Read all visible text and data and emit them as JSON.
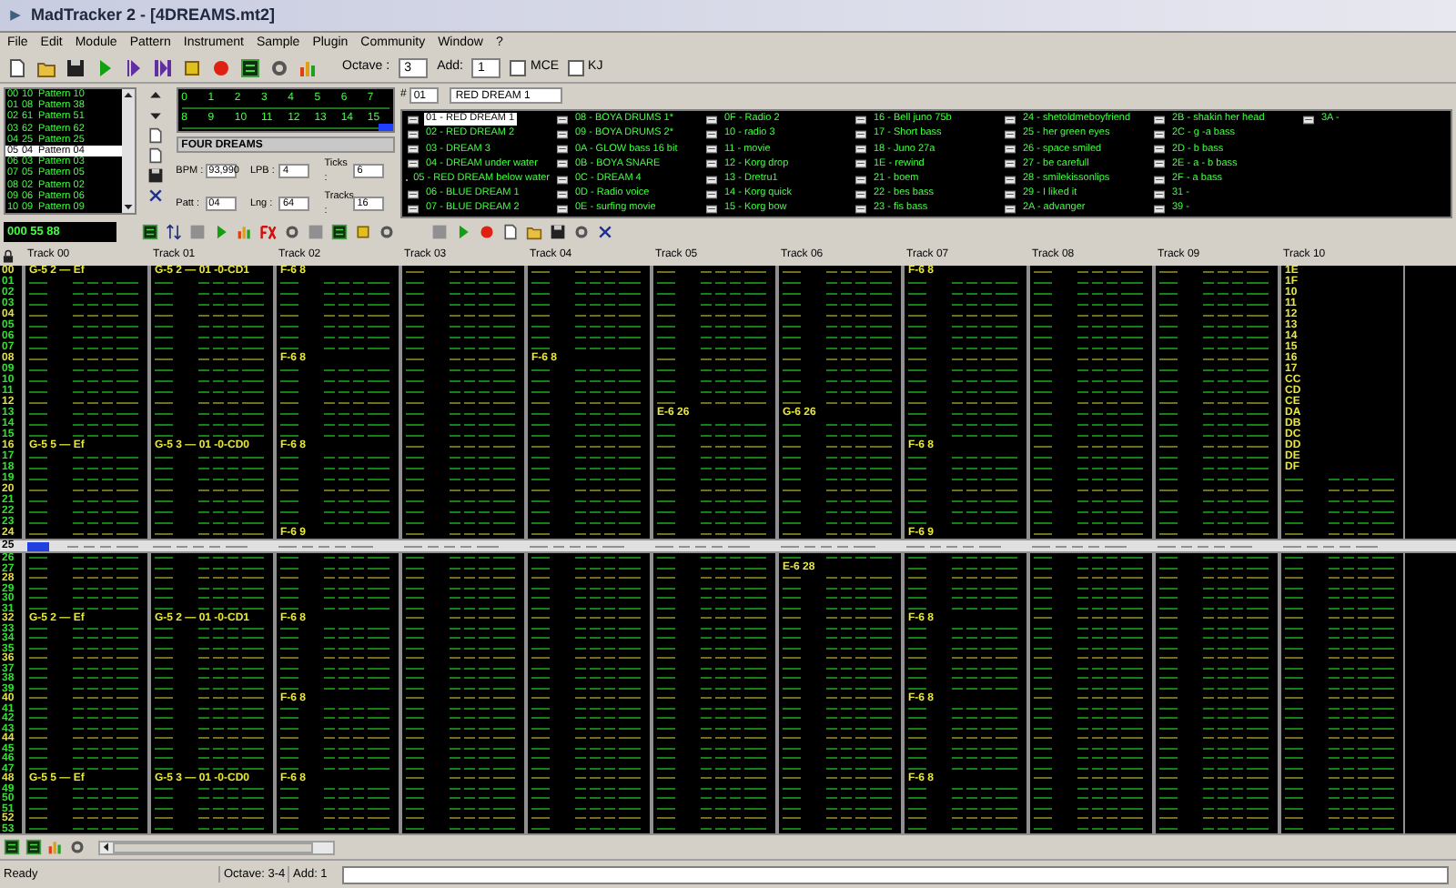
{
  "window": {
    "title": "MadTracker 2 - [4DREAMS.mt2]"
  },
  "menu": [
    "File",
    "Edit",
    "Module",
    "Pattern",
    "Instrument",
    "Sample",
    "Plugin",
    "Community",
    "Window",
    "?"
  ],
  "toolbar": {
    "octave_label": "Octave :",
    "octave": "3",
    "add_label": "Add:",
    "add": "1",
    "checkboxes": [
      {
        "label": "MCE",
        "checked": false
      },
      {
        "label": "KJ",
        "checked": false
      }
    ]
  },
  "pattern_list": [
    {
      "index": "00",
      "pattern": "10",
      "name": "Pattern 10",
      "selected": false
    },
    {
      "index": "01",
      "pattern": "08",
      "name": "Pattern 38",
      "selected": false
    },
    {
      "index": "02",
      "pattern": "61",
      "name": "Pattern 51",
      "selected": false
    },
    {
      "index": "03",
      "pattern": "62",
      "name": "Pattern 62",
      "selected": false
    },
    {
      "index": "04",
      "pattern": "25",
      "name": "Pattern 25",
      "selected": false
    },
    {
      "index": "05",
      "pattern": "04",
      "name": "Pattern 04",
      "selected": true
    },
    {
      "index": "06",
      "pattern": "03",
      "name": "Pattern 03",
      "selected": false
    },
    {
      "index": "07",
      "pattern": "05",
      "name": "Pattern 05",
      "selected": false
    },
    {
      "index": "08",
      "pattern": "02",
      "name": "Pattern 02",
      "selected": false
    },
    {
      "index": "09",
      "pattern": "06",
      "name": "Pattern 06",
      "selected": false
    },
    {
      "index": "10",
      "pattern": "09",
      "name": "Pattern 09",
      "selected": false
    }
  ],
  "order_grid": [
    [
      "0",
      "1",
      "2",
      "3",
      "4",
      "5",
      "6",
      "7"
    ],
    [
      "8",
      "9",
      "10",
      "11",
      "12",
      "13",
      "14",
      "15"
    ]
  ],
  "song": {
    "name": "FOUR DREAMS",
    "fields": [
      {
        "label": "BPM :",
        "value": "93,990"
      },
      {
        "label": "LPB :",
        "value": "4"
      },
      {
        "label": "Ticks :",
        "value": "6"
      },
      {
        "label": "Patt :",
        "value": "04"
      },
      {
        "label": "Lng :",
        "value": "64"
      },
      {
        "label": "Tracks :",
        "value": "16"
      }
    ]
  },
  "instrument": {
    "number_label": "#",
    "number": "01",
    "name": "RED DREAM 1",
    "columns": [
      [
        {
          "label": "01 - RED DREAM 1",
          "selected": true
        },
        {
          "label": "02 - RED DREAM 2",
          "selected": false
        },
        {
          "label": "03 - DREAM 3",
          "selected": false
        },
        {
          "label": "04 - DREAM under water",
          "selected": false
        },
        {
          "label": "05 - RED DREAM below water",
          "selected": false
        },
        {
          "label": "06 - BLUE DREAM 1",
          "selected": false
        },
        {
          "label": "07 - BLUE DREAM 2",
          "selected": false
        }
      ],
      [
        {
          "label": "08 - BOYA DRUMS 1*",
          "selected": false
        },
        {
          "label": "09 - BOYA DRUMS 2*",
          "selected": false
        },
        {
          "label": "0A - GLOW bass 16 bit",
          "selected": false
        },
        {
          "label": "0B - BOYA SNARE",
          "selected": false
        },
        {
          "label": "0C - DREAM 4",
          "selected": false
        },
        {
          "label": "0D - Radio voice",
          "selected": false
        },
        {
          "label": "0E - surfing movie",
          "selected": false
        }
      ],
      [
        {
          "label": "0F - Radio 2",
          "selected": false
        },
        {
          "label": "10 - radio 3",
          "selected": false
        },
        {
          "label": "11 - movie",
          "selected": false
        },
        {
          "label": "12 - Korg drop",
          "selected": false
        },
        {
          "label": "13 - Dretru1",
          "selected": false
        },
        {
          "label": "14 - Korg quick",
          "selected": false
        },
        {
          "label": "15 - Korg bow",
          "selected": false
        }
      ],
      [
        {
          "label": "16 - Bell juno 75b",
          "selected": false
        },
        {
          "label": "17 - Short bass",
          "selected": false
        },
        {
          "label": "18 - Juno 27a",
          "selected": false
        },
        {
          "label": "1E - rewind",
          "selected": false
        },
        {
          "label": "21 - boem",
          "selected": false
        },
        {
          "label": "22 - bes bass",
          "selected": false
        },
        {
          "label": "23 - fis bass",
          "selected": false
        }
      ],
      [
        {
          "label": "24 - shetoldmeboyfriend",
          "selected": false
        },
        {
          "label": "25 - her green eyes",
          "selected": false
        },
        {
          "label": "26 - space smiled",
          "selected": false
        },
        {
          "label": "27 - be carefull",
          "selected": false
        },
        {
          "label": "28 - smilekissonlips",
          "selected": false
        },
        {
          "label": "29 - I liked it",
          "selected": false
        },
        {
          "label": "2A - advanger",
          "selected": false
        }
      ],
      [
        {
          "label": "2B - shakin her head",
          "selected": false
        },
        {
          "label": "2C - g -a bass",
          "selected": false
        },
        {
          "label": "2D - b bass",
          "selected": false
        },
        {
          "label": "2E - a - b bass",
          "selected": false
        },
        {
          "label": "2F - a bass",
          "selected": false
        },
        {
          "label": "31 -",
          "selected": false
        },
        {
          "label": "39 -",
          "selected": false
        }
      ],
      [
        {
          "label": "3A -",
          "selected": false
        }
      ]
    ]
  },
  "time_display": "000 55 88",
  "tracks": [
    "Track 00",
    "Track 01",
    "Track 02",
    "Track 03",
    "Track 04",
    "Track 05",
    "Track 06",
    "Track 07",
    "Track 08",
    "Track 09",
    "Track 10"
  ],
  "rows_above": [
    {
      "number": "00",
      "cells": [
        "G-5 2 — Ef",
        "G-5 2 — 01 -0-CD1",
        "F-6 8",
        null,
        null,
        null,
        null,
        "F-6 8",
        null,
        null,
        "1E"
      ]
    },
    {
      "number": "01",
      "cells": [
        null,
        null,
        null,
        null,
        null,
        null,
        null,
        null,
        null,
        null,
        "1F"
      ]
    },
    {
      "number": "02",
      "cells": [
        null,
        null,
        null,
        null,
        null,
        null,
        null,
        null,
        null,
        null,
        "10"
      ]
    },
    {
      "number": "03",
      "cells": [
        null,
        null,
        null,
        null,
        null,
        null,
        null,
        null,
        null,
        null,
        "11"
      ]
    },
    {
      "number": "04",
      "cells": [
        null,
        null,
        null,
        null,
        null,
        null,
        null,
        null,
        null,
        null,
        "12"
      ]
    },
    {
      "number": "05",
      "cells": [
        null,
        null,
        null,
        null,
        null,
        null,
        null,
        null,
        null,
        null,
        "13"
      ]
    },
    {
      "number": "06",
      "cells": [
        null,
        null,
        null,
        null,
        null,
        null,
        null,
        null,
        null,
        null,
        "14"
      ]
    },
    {
      "number": "07",
      "cells": [
        null,
        null,
        null,
        null,
        null,
        null,
        null,
        null,
        null,
        null,
        "15"
      ]
    },
    {
      "number": "08",
      "cells": [
        null,
        null,
        "F-6 8",
        null,
        "F-6 8",
        null,
        null,
        null,
        null,
        null,
        "16"
      ]
    },
    {
      "number": "09",
      "cells": [
        null,
        null,
        null,
        null,
        null,
        null,
        null,
        null,
        null,
        null,
        "17"
      ]
    },
    {
      "number": "10",
      "cells": [
        null,
        null,
        null,
        null,
        null,
        null,
        null,
        null,
        null,
        null,
        "CC"
      ]
    },
    {
      "number": "11",
      "cells": [
        null,
        null,
        null,
        null,
        null,
        null,
        null,
        null,
        null,
        null,
        "CD"
      ]
    },
    {
      "number": "12",
      "cells": [
        null,
        null,
        null,
        null,
        null,
        null,
        null,
        null,
        null,
        null,
        "CE"
      ]
    },
    {
      "number": "13",
      "cells": [
        null,
        null,
        null,
        null,
        null,
        "E-6 26",
        "G-6 26",
        null,
        null,
        null,
        "DA"
      ]
    },
    {
      "number": "14",
      "cells": [
        null,
        null,
        null,
        null,
        null,
        null,
        null,
        null,
        null,
        null,
        "DB"
      ]
    },
    {
      "number": "15",
      "cells": [
        null,
        null,
        null,
        null,
        null,
        null,
        null,
        null,
        null,
        null,
        "DC"
      ]
    },
    {
      "number": "16",
      "cells": [
        "G-5 5 — Ef",
        "G-5 3 — 01 -0-CD0",
        "F-6 8",
        null,
        null,
        null,
        null,
        "F-6 8",
        null,
        null,
        "DD"
      ]
    },
    {
      "number": "17",
      "cells": [
        null,
        null,
        null,
        null,
        null,
        null,
        null,
        null,
        null,
        null,
        "DE"
      ]
    },
    {
      "number": "18",
      "cells": [
        null,
        null,
        null,
        null,
        null,
        null,
        null,
        null,
        null,
        null,
        "DF"
      ]
    },
    {
      "number": "19"
    },
    {
      "number": "20"
    },
    {
      "number": "21"
    },
    {
      "number": "22"
    },
    {
      "number": "23"
    },
    {
      "number": "24",
      "cells": [
        null,
        null,
        "F-6 9",
        null,
        null,
        null,
        null,
        "F-6 9"
      ]
    }
  ],
  "cursor_row": {
    "number": "25"
  },
  "rows_below": [
    {
      "number": "26"
    },
    {
      "number": "27",
      "cells": [
        null,
        null,
        null,
        null,
        null,
        null,
        "E-6 28"
      ]
    },
    {
      "number": "28"
    },
    {
      "number": "29"
    },
    {
      "number": "30"
    },
    {
      "number": "31"
    },
    {
      "number": "32",
      "cells": [
        "G-5 2 — Ef",
        "G-5 2 — 01 -0-CD1",
        "F-6 8",
        null,
        null,
        null,
        null,
        "F-6 8"
      ]
    },
    {
      "number": "33"
    },
    {
      "number": "34"
    },
    {
      "number": "35"
    },
    {
      "number": "36"
    },
    {
      "number": "37"
    },
    {
      "number": "38"
    },
    {
      "number": "39"
    },
    {
      "number": "40",
      "cells": [
        null,
        null,
        "F-6 8",
        null,
        null,
        null,
        null,
        "F-6 8"
      ]
    },
    {
      "number": "41"
    },
    {
      "number": "42"
    },
    {
      "number": "43"
    },
    {
      "number": "44"
    },
    {
      "number": "45"
    },
    {
      "number": "46"
    },
    {
      "number": "47"
    },
    {
      "number": "48",
      "cells": [
        "G-5 5 — Ef",
        "G-5 3 — 01 -0-CD0",
        "F-6 8",
        null,
        null,
        null,
        null,
        "F-6 8"
      ]
    },
    {
      "number": "49"
    },
    {
      "number": "50"
    },
    {
      "number": "51"
    },
    {
      "number": "52"
    },
    {
      "number": "53"
    }
  ],
  "status_bar": {
    "status": "Ready",
    "octave": "Octave: 3-4",
    "add": "Add: 1"
  }
}
